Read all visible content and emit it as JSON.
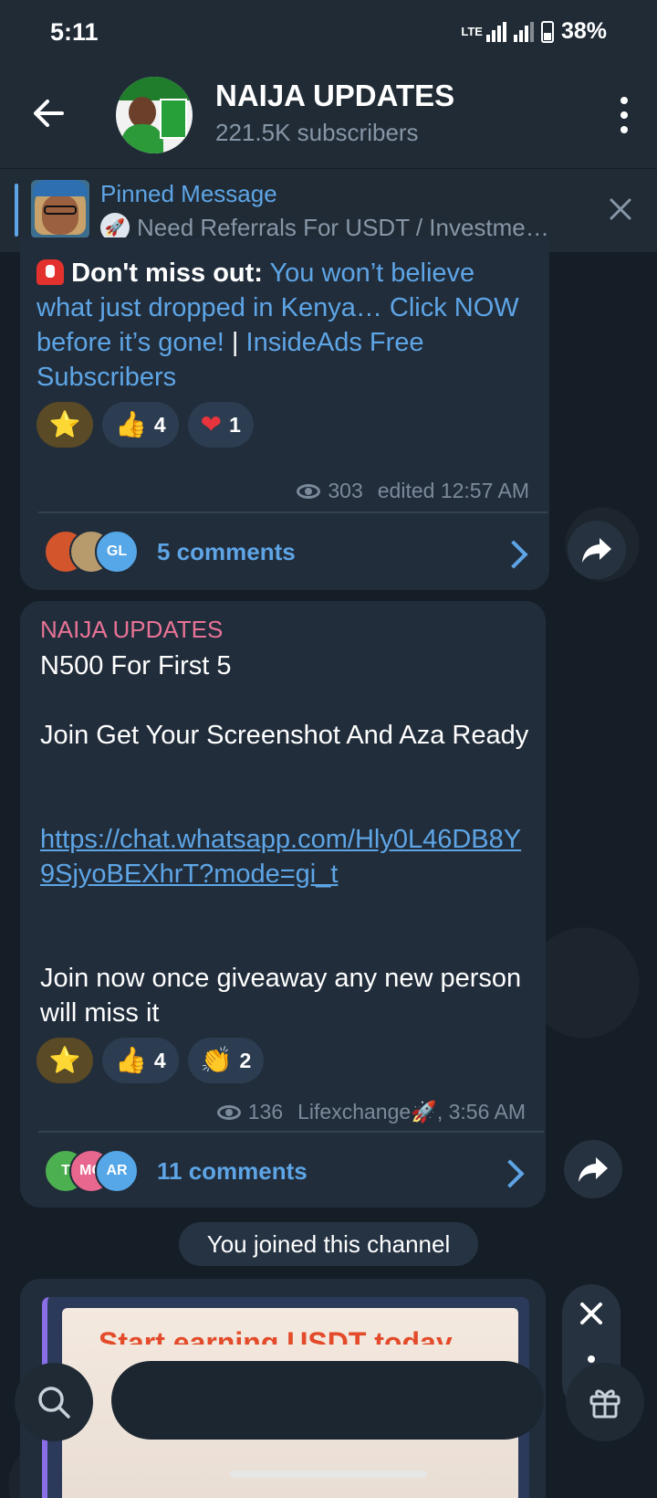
{
  "status_bar": {
    "time": "5:11",
    "network": "LTE",
    "battery": "38%"
  },
  "header": {
    "title": "NAIJA UPDATES",
    "subtitle": "221.5K subscribers"
  },
  "pinned": {
    "title": "Pinned Message",
    "text": "Need Referrals For USDT / Investme…"
  },
  "messages": [
    {
      "bold_prefix": "Don't miss out:",
      "link_text": "You won’t believe what just dropped in Kenya… Click NOW before it’s gone!",
      "separator": "|",
      "link2_text": "InsideAds Free Subscribers",
      "reactions": [
        {
          "emoji": "⭐",
          "count": ""
        },
        {
          "emoji": "👍",
          "count": "4"
        },
        {
          "emoji": "❤",
          "count": "1"
        }
      ],
      "views": "303",
      "edited": "edited 12:57 AM",
      "comments_label": "5 comments",
      "commenters": [
        "",
        "",
        "GL"
      ]
    },
    {
      "sender": "NAIJA UPDATES",
      "line1": "N500 For First 5",
      "line2": "Join Get Your Screenshot And Aza Ready",
      "url": "https://chat.whatsapp.com/Hly0L46DB8Y9SjyoBEXhrT?mode=gi_t",
      "line3": "Join now once giveaway any new person will miss it",
      "reactions": [
        {
          "emoji": "⭐",
          "count": ""
        },
        {
          "emoji": "👍",
          "count": "4"
        },
        {
          "emoji": "👏",
          "count": "2"
        }
      ],
      "views": "136",
      "author_time": "Lifexchange🚀, 3:56 AM",
      "comments_label": "11 comments",
      "commenters": [
        "T",
        "MG",
        "AR"
      ]
    }
  ],
  "service_message": "You joined this channel",
  "ad": {
    "headline": "Start earning USDT today"
  },
  "colors": {
    "accent": "#5ea5e6",
    "sender": "#e87396",
    "bubble": "#212d3b"
  }
}
